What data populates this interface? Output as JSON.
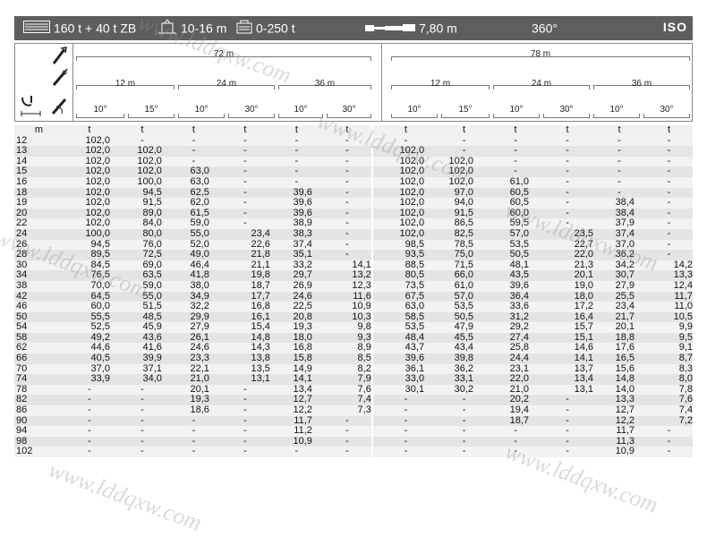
{
  "header": {
    "capacity": "160 t + 40 t ZB",
    "outrigger": "10-16 m",
    "counterweight": "0-250 t",
    "base_width": "7,80 m",
    "slew": "360°",
    "norm": "ISO"
  },
  "boom_lengths": [
    "72 m",
    "78 m"
  ],
  "jib_lengths": [
    "12 m",
    "24 m",
    "36 m",
    "12 m",
    "24 m",
    "36 m"
  ],
  "angles": [
    "10°",
    "15°",
    "10°",
    "30°",
    "10°",
    "30°",
    "10°",
    "15°",
    "10°",
    "30°",
    "10°",
    "30°"
  ],
  "unit_row": [
    "m",
    "t",
    "t",
    "t",
    "t",
    "t",
    "t",
    "t",
    "t",
    "t",
    "t",
    "t",
    "t"
  ],
  "rows": [
    [
      "12",
      "102,0",
      "-",
      "-",
      "-",
      "-",
      "-",
      "-",
      "-",
      "-",
      "-",
      "-",
      "-"
    ],
    [
      "13",
      "102,0",
      "102,0",
      "-",
      "-",
      "-",
      "-",
      "102,0",
      "-",
      "-",
      "-",
      "-",
      "-"
    ],
    [
      "14",
      "102,0",
      "102,0",
      "-",
      "-",
      "-",
      "-",
      "102,0",
      "102,0",
      "-",
      "-",
      "-",
      "-"
    ],
    [
      "15",
      "102,0",
      "102,0",
      "63,0",
      "-",
      "-",
      "-",
      "102,0",
      "102,0",
      "-",
      "-",
      "-",
      "-"
    ],
    [
      "16",
      "102,0",
      "100,0",
      "63,0",
      "-",
      "-",
      "-",
      "102,0",
      "102,0",
      "61,0",
      "-",
      "-",
      "-"
    ],
    [
      "18",
      "102,0",
      "94,5",
      "62,5",
      "-",
      "39,6",
      "-",
      "102,0",
      "97,0",
      "60,5",
      "-",
      "-",
      "-"
    ],
    [
      "19",
      "102,0",
      "91,5",
      "62,0",
      "-",
      "39,6",
      "-",
      "102,0",
      "94,0",
      "60,5",
      "-",
      "38,4",
      "-"
    ],
    [
      "20",
      "102,0",
      "89,0",
      "61,5",
      "-",
      "39,6",
      "-",
      "102,0",
      "91,5",
      "60,0",
      "-",
      "38,4",
      "-"
    ],
    [
      "22",
      "102,0",
      "84,0",
      "59,0",
      "-",
      "38,9",
      "-",
      "102,0",
      "86,5",
      "59,5",
      "-",
      "37,9",
      "-"
    ],
    [
      "24",
      "100,0",
      "80,0",
      "55,0",
      "23,4",
      "38,3",
      "-",
      "102,0",
      "82,5",
      "57,0",
      "23,5",
      "37,4",
      "-"
    ],
    [
      "26",
      "94,5",
      "76,0",
      "52,0",
      "22,6",
      "37,4",
      "-",
      "98,5",
      "78,5",
      "53,5",
      "22,7",
      "37,0",
      "-"
    ],
    [
      "28",
      "89,5",
      "72,5",
      "49,0",
      "21,8",
      "35,1",
      "-",
      "93,5",
      "75,0",
      "50,5",
      "22,0",
      "36,2",
      "-"
    ],
    [
      "30",
      "84,5",
      "69,0",
      "46,4",
      "21,1",
      "33,2",
      "14,1",
      "88,5",
      "71,5",
      "48,1",
      "21,3",
      "34,2",
      "14,2"
    ],
    [
      "34",
      "76,5",
      "63,5",
      "41,8",
      "19,8",
      "29,7",
      "13,2",
      "80,5",
      "66,0",
      "43,5",
      "20,1",
      "30,7",
      "13,3"
    ],
    [
      "38",
      "70,0",
      "59,0",
      "38,0",
      "18,7",
      "26,9",
      "12,3",
      "73,5",
      "61,0",
      "39,6",
      "19,0",
      "27,9",
      "12,4"
    ],
    [
      "42",
      "64,5",
      "55,0",
      "34,9",
      "17,7",
      "24,6",
      "11,6",
      "67,5",
      "57,0",
      "36,4",
      "18,0",
      "25,5",
      "11,7"
    ],
    [
      "46",
      "60,0",
      "51,5",
      "32,2",
      "16,8",
      "22,5",
      "10,9",
      "63,0",
      "53,5",
      "33,6",
      "17,2",
      "23,4",
      "11,0"
    ],
    [
      "50",
      "55,5",
      "48,5",
      "29,9",
      "16,1",
      "20,8",
      "10,3",
      "58,5",
      "50,5",
      "31,2",
      "16,4",
      "21,7",
      "10,5"
    ],
    [
      "54",
      "52,5",
      "45,9",
      "27,9",
      "15,4",
      "19,3",
      "9,8",
      "53,5",
      "47,9",
      "29,2",
      "15,7",
      "20,1",
      "9,9"
    ],
    [
      "58",
      "49,2",
      "43,6",
      "26,1",
      "14,8",
      "18,0",
      "9,3",
      "48,4",
      "45,5",
      "27,4",
      "15,1",
      "18,8",
      "9,5"
    ],
    [
      "62",
      "44,6",
      "41,6",
      "24,6",
      "14,3",
      "16,8",
      "8,9",
      "43,7",
      "43,4",
      "25,8",
      "14,6",
      "17,6",
      "9,1"
    ],
    [
      "66",
      "40,5",
      "39,9",
      "23,3",
      "13,8",
      "15,8",
      "8,5",
      "39,6",
      "39,8",
      "24,4",
      "14,1",
      "16,5",
      "8,7"
    ],
    [
      "70",
      "37,0",
      "37,1",
      "22,1",
      "13,5",
      "14,9",
      "8,2",
      "36,1",
      "36,2",
      "23,1",
      "13,7",
      "15,6",
      "8,3"
    ],
    [
      "74",
      "33,9",
      "34,0",
      "21,0",
      "13,1",
      "14,1",
      "7,9",
      "33,0",
      "33,1",
      "22,0",
      "13,4",
      "14,8",
      "8,0"
    ],
    [
      "78",
      "-",
      "-",
      "20,1",
      "-",
      "13,4",
      "7,6",
      "30,1",
      "30,2",
      "21,0",
      "13,1",
      "14,0",
      "7,8"
    ],
    [
      "82",
      "-",
      "-",
      "19,3",
      "-",
      "12,7",
      "7,4",
      "-",
      "-",
      "20,2",
      "-",
      "13,3",
      "7,6"
    ],
    [
      "86",
      "-",
      "-",
      "18,6",
      "-",
      "12,2",
      "7,3",
      "-",
      "-",
      "19,4",
      "-",
      "12,7",
      "7,4"
    ],
    [
      "90",
      "-",
      "-",
      "-",
      "-",
      "11,7",
      "-",
      "-",
      "-",
      "18,7",
      "-",
      "12,2",
      "7,2"
    ],
    [
      "94",
      "-",
      "-",
      "-",
      "-",
      "11,2",
      "-",
      "-",
      "-",
      "-",
      "-",
      "11,7",
      "-"
    ],
    [
      "98",
      "-",
      "-",
      "-",
      "-",
      "10,9",
      "-",
      "-",
      "-",
      "-",
      "-",
      "11,3",
      "-"
    ],
    [
      "102",
      "-",
      "-",
      "-",
      "-",
      "-",
      "-",
      "-",
      "-",
      "-",
      "-",
      "10,9",
      "-"
    ]
  ],
  "watermark": "www.lddqxw.com"
}
